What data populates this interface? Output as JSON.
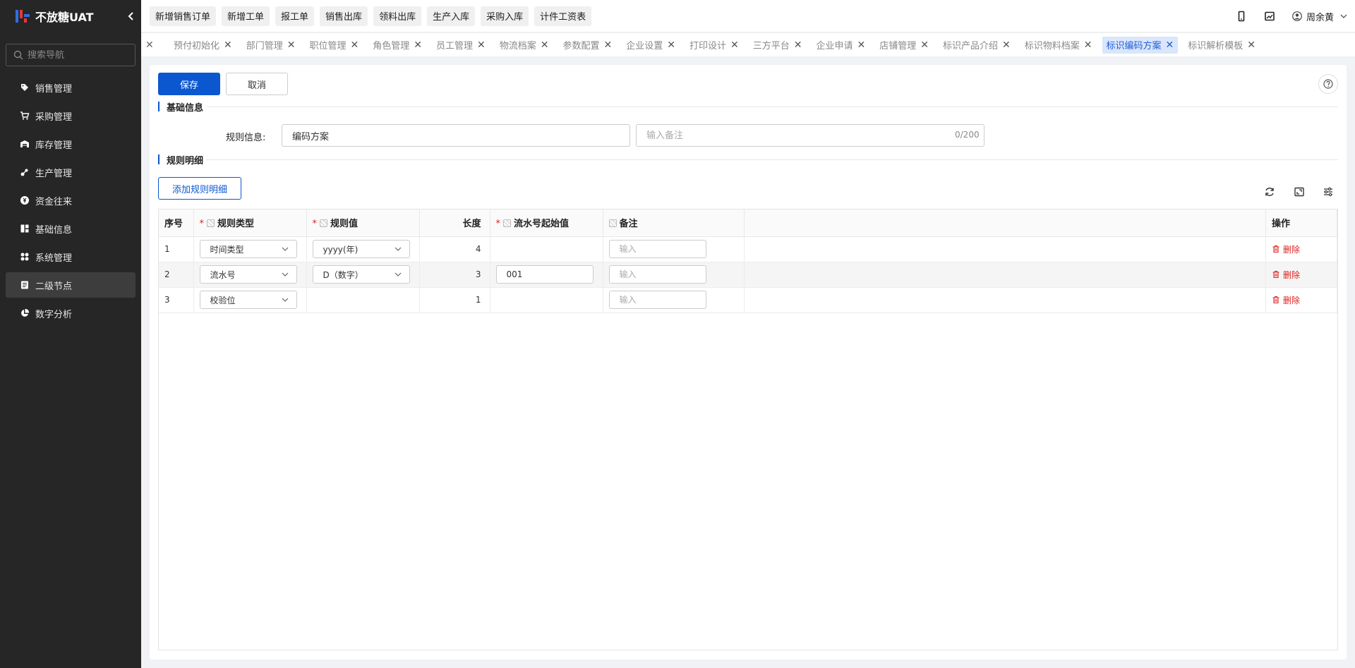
{
  "app": {
    "brand_name": "不放糖UAT",
    "search_placeholder": "搜索导航"
  },
  "sidebar": {
    "items": [
      {
        "label": "销售管理",
        "icon": "tag-icon"
      },
      {
        "label": "采购管理",
        "icon": "cart-icon"
      },
      {
        "label": "库存管理",
        "icon": "warehouse-icon"
      },
      {
        "label": "生产管理",
        "icon": "production-icon"
      },
      {
        "label": "资金往来",
        "icon": "money-icon"
      },
      {
        "label": "基础信息",
        "icon": "info-icon"
      },
      {
        "label": "系统管理",
        "icon": "system-icon"
      },
      {
        "label": "二级节点",
        "icon": "document-icon"
      },
      {
        "label": "数字分析",
        "icon": "pie-chart-icon"
      }
    ],
    "active_index": 7
  },
  "quick_actions": [
    "新增销售订单",
    "新增工单",
    "报工单",
    "销售出库",
    "领料出库",
    "生产入库",
    "采购入库",
    "计件工资表"
  ],
  "user": {
    "name": "周余黄"
  },
  "tabs": {
    "items": [
      "预付初始化",
      "部门管理",
      "职位管理",
      "角色管理",
      "员工管理",
      "物流档案",
      "参数配置",
      "企业设置",
      "打印设计",
      "三方平台",
      "企业申请",
      "店铺管理",
      "标识产品介绍",
      "标识物料档案",
      "标识编码方案",
      "标识解析模板"
    ],
    "active_label": "标识编码方案",
    "close_glyph": "✕"
  },
  "form": {
    "save_label": "保存",
    "cancel_label": "取消",
    "section_basic": "基础信息",
    "rule_info_label": "规则信息:",
    "rule_info_value": "编码方案",
    "remark_placeholder": "输入备注",
    "remark_counter": "0/200",
    "section_detail": "规则明细",
    "add_detail_label": "添加规则明细"
  },
  "table": {
    "columns": {
      "index": "序号",
      "rule_type": "规则类型",
      "rule_value": "规则值",
      "length": "长度",
      "serial_start": "流水号起始值",
      "remark": "备注",
      "actions": "操作"
    },
    "remark_placeholder": "输入",
    "delete_label": "删除",
    "rows": [
      {
        "index": "1",
        "rule_type": "时间类型",
        "rule_value": "yyyy(年)",
        "length": "4",
        "serial_start": ""
      },
      {
        "index": "2",
        "rule_type": "流水号",
        "rule_value": "D（数字）",
        "length": "3",
        "serial_start": "001"
      },
      {
        "index": "3",
        "rule_type": "校验位",
        "rule_value": "",
        "length": "1",
        "serial_start": ""
      }
    ]
  },
  "colors": {
    "primary": "#0b57d0",
    "sidebar_bg": "#262626",
    "danger": "#e02020",
    "active_tab_bg": "#d9e6fb"
  }
}
